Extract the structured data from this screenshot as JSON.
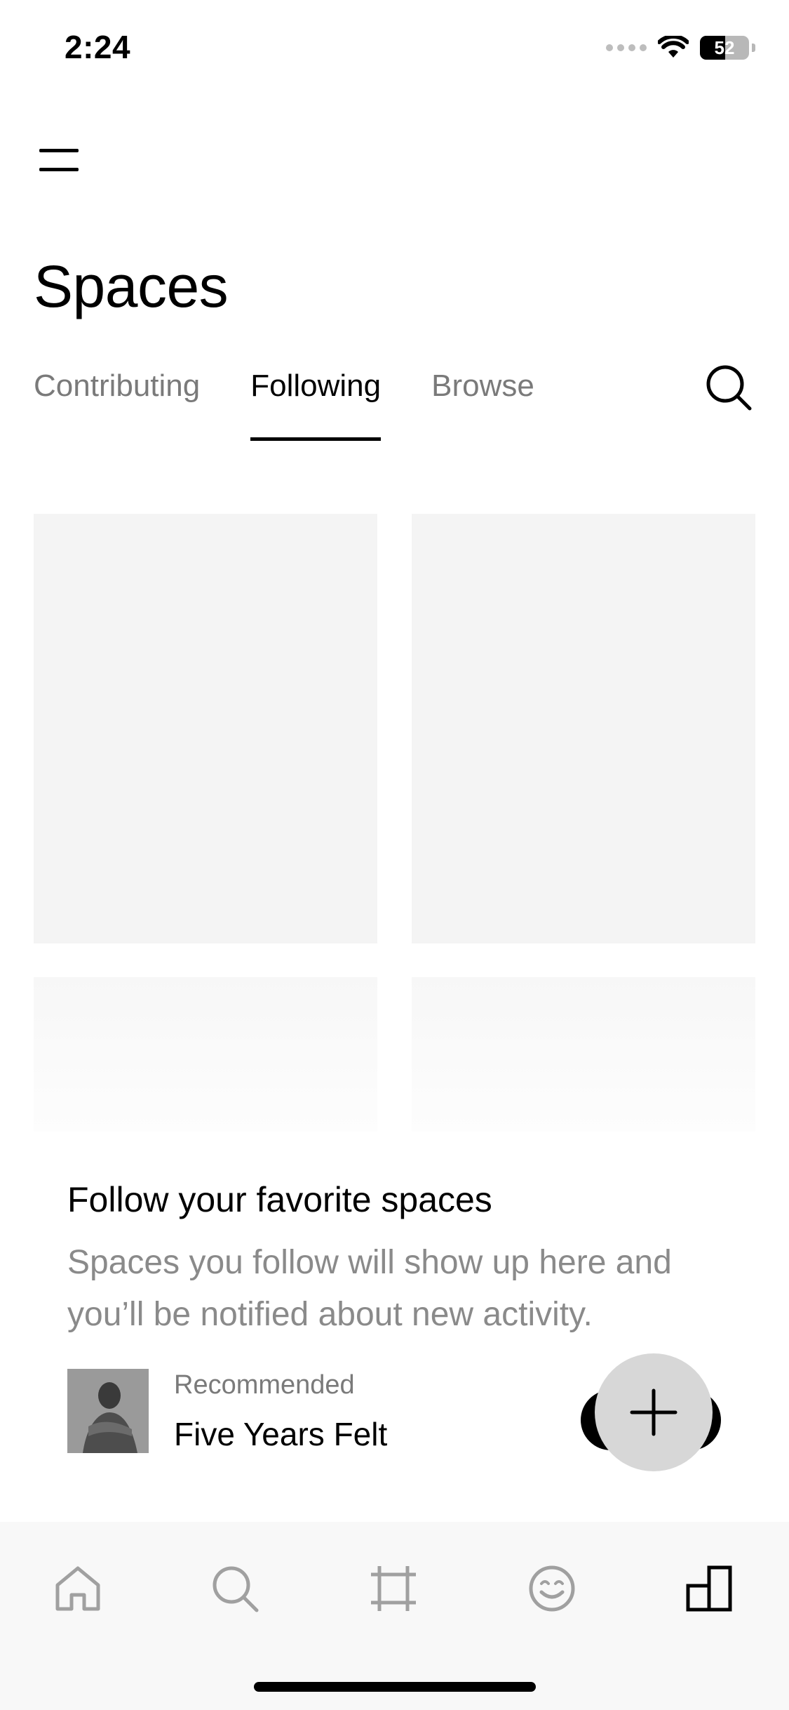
{
  "status_bar": {
    "time": "2:24",
    "battery_percent": "52",
    "battery_level": 0.52
  },
  "header": {
    "title": "Spaces"
  },
  "tabs": [
    {
      "label": "Contributing",
      "active": false
    },
    {
      "label": "Following",
      "active": true
    },
    {
      "label": "Browse",
      "active": false
    }
  ],
  "empty_state": {
    "title": "Follow your favorite spaces",
    "description": "Spaces you follow will show up here and you’ll be notified about new activity."
  },
  "recommended": {
    "label": "Recommended",
    "name": "Five Years Felt"
  },
  "bottom_nav": [
    {
      "icon": "home-icon",
      "active": false
    },
    {
      "icon": "search-icon",
      "active": false
    },
    {
      "icon": "crop-frame-icon",
      "active": false
    },
    {
      "icon": "smiley-icon",
      "active": false
    },
    {
      "icon": "spaces-icon",
      "active": true
    }
  ],
  "colors": {
    "text_primary": "#000000",
    "text_secondary": "#7a7a7a",
    "placeholder": "#f4f4f4",
    "tab_bar_bg": "#f8f8f8",
    "fab_bg": "#d7d7d7",
    "icon_inactive": "#a0a0a0"
  }
}
